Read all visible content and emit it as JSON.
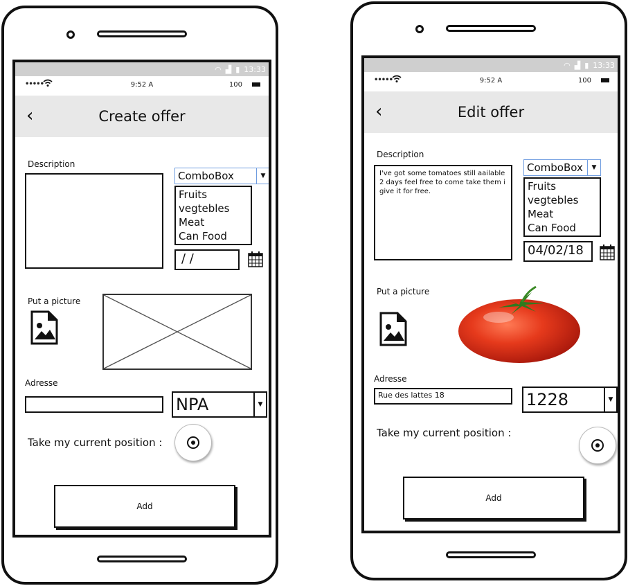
{
  "system_bar": {
    "time": "13:33"
  },
  "status_bar": {
    "signal": "•••••",
    "time": "9:52 A",
    "battery": "100"
  },
  "screens": [
    {
      "title": "Create offer",
      "description_label": "Description",
      "description_text": "",
      "combo_value": "ComboBox",
      "combo_options": [
        "Fruits",
        "vegtebles",
        "Meat",
        "Can Food"
      ],
      "date_value": "/ /",
      "picture_label": "Put a picture",
      "address_label": "Adresse",
      "address_value": "",
      "npa_value": "NPA",
      "position_label": "Take my current position :",
      "add_button": "Add"
    },
    {
      "title": "Edit offer",
      "description_label": "Description",
      "description_text": "I've got some tomatoes still aailable 2 days feel free to come take them i give it for free.",
      "combo_value": "ComboBox",
      "combo_options": [
        "Fruits",
        "vegtebles",
        "Meat",
        "Can Food"
      ],
      "date_value": "04/02/18",
      "picture_label": "Put a picture",
      "address_label": "Adresse",
      "address_value": "Rue des lattes 18",
      "npa_value": "1228",
      "position_label": "Take my current position :",
      "add_button": "Add"
    }
  ],
  "colors": {
    "combo_border": "#6f9de0",
    "navbar": "#e8e8e8",
    "system_bar": "#cfcfcf",
    "tomato": "#e0341a"
  }
}
